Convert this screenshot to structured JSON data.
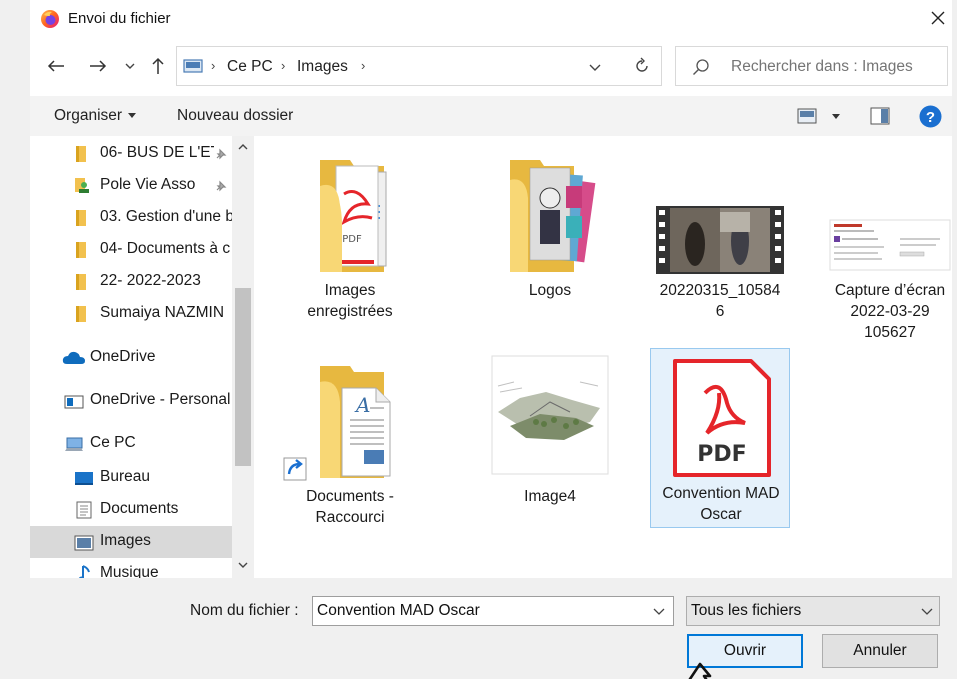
{
  "window": {
    "title": "Envoi du fichier",
    "app_icon": "firefox-logo-icon"
  },
  "address": {
    "segments": [
      "Ce PC",
      "Images"
    ],
    "search_placeholder": "Rechercher dans : Images"
  },
  "toolbar": {
    "organize": "Organiser",
    "new_folder": "Nouveau dossier"
  },
  "nav": {
    "items": [
      {
        "label": "06- BUS DE L'ET",
        "icon": "folder-icon",
        "pinned": true
      },
      {
        "label": "Pole Vie Asso",
        "icon": "folder-user-icon",
        "pinned": true
      },
      {
        "label": "03. Gestion d'une b",
        "icon": "folder-icon",
        "pinned": false
      },
      {
        "label": "04- Documents à c",
        "icon": "folder-icon",
        "pinned": false
      },
      {
        "label": "22- 2022-2023",
        "icon": "folder-icon",
        "pinned": false
      },
      {
        "label": "Sumaiya NAZMIN",
        "icon": "folder-icon",
        "pinned": false
      },
      {
        "label": "OneDrive",
        "icon": "onedrive-cloud-icon",
        "pinned": false
      },
      {
        "label": "OneDrive - Personal",
        "icon": "onedrive-personal-icon",
        "pinned": false
      },
      {
        "label": "Ce PC",
        "icon": "computer-icon",
        "pinned": false
      },
      {
        "label": "Bureau",
        "icon": "desktop-icon",
        "pinned": false
      },
      {
        "label": "Documents",
        "icon": "documents-icon",
        "pinned": false
      },
      {
        "label": "Images",
        "icon": "pictures-icon",
        "pinned": false,
        "selected": true
      },
      {
        "label": "Musique",
        "icon": "music-icon",
        "pinned": false
      }
    ]
  },
  "files": [
    {
      "name_lines": [
        "Images",
        "enregistrées"
      ],
      "kind": "folder-pdf-icon"
    },
    {
      "name_lines": [
        "Logos"
      ],
      "kind": "folder-images-icon"
    },
    {
      "name_lines": [
        "20220315_10584",
        "6"
      ],
      "kind": "video-thumbnail"
    },
    {
      "name_lines": [
        "Capture d’écran",
        "2022-03-29",
        "105627"
      ],
      "kind": "screenshot-thumbnail"
    },
    {
      "name_lines": [
        "Documents -",
        "Raccourci"
      ],
      "kind": "folder-shortcut-icon"
    },
    {
      "name_lines": [
        "Image4"
      ],
      "kind": "image-thumbnail"
    },
    {
      "name_lines": [
        "Convention MAD",
        "Oscar"
      ],
      "kind": "pdf-icon",
      "selected": true
    }
  ],
  "footer": {
    "filename_label": "Nom du fichier :",
    "filename_value": "Convention MAD Oscar",
    "filetype": "Tous les fichiers",
    "open_label": "Ouvrir",
    "cancel_label": "Annuler"
  },
  "colors": {
    "accent": "#0078d7",
    "folder": "#f8d775",
    "pdf_red": "#e5252a",
    "help_blue": "#1a6fd0"
  }
}
